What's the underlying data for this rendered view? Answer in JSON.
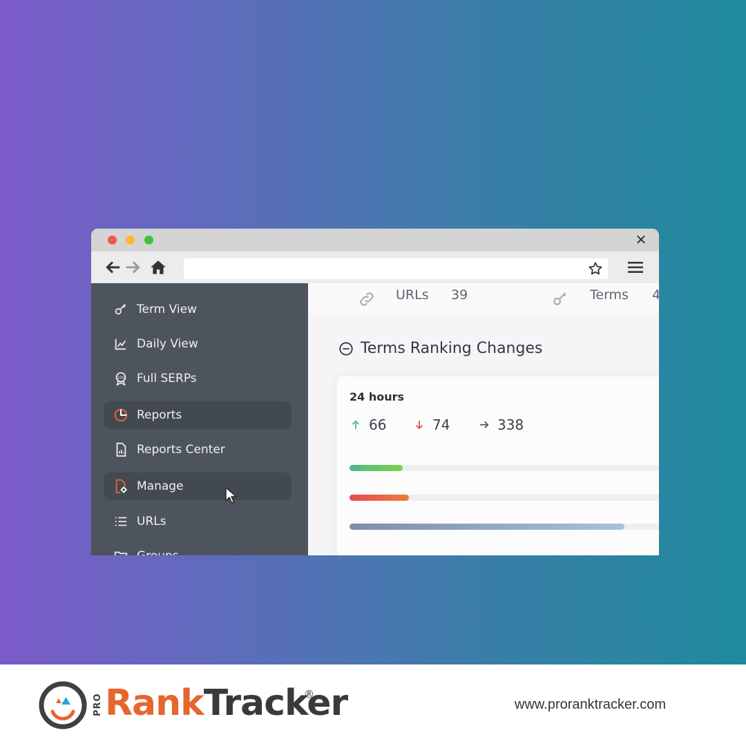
{
  "browser": {
    "url": ""
  },
  "stats": {
    "urls_label": "URLs",
    "urls_value": "39",
    "terms_label": "Terms",
    "terms_value": "4"
  },
  "sidebar": {
    "items": [
      {
        "label": "Term View",
        "icon": "key-icon",
        "active": false
      },
      {
        "label": "Daily View",
        "icon": "line-chart-icon",
        "active": false
      },
      {
        "label": "Full SERPs",
        "icon": "serp-100-badge-icon",
        "active": false
      },
      {
        "label": "Reports",
        "icon": "pie-chart-icon",
        "active": true
      },
      {
        "label": "Reports Center",
        "icon": "report-document-icon",
        "active": false
      },
      {
        "label": "Manage",
        "icon": "manage-document-gear-icon",
        "active": true
      },
      {
        "label": "URLs",
        "icon": "list-icon",
        "active": false
      },
      {
        "label": "Groups",
        "icon": "folder-icon",
        "active": false
      }
    ]
  },
  "main": {
    "section_title": "Terms Ranking Changes",
    "period": "24 hours",
    "up_count": "66",
    "down_count": "74",
    "same_count": "338",
    "bars": {
      "up_fraction": 0.16,
      "down_fraction": 0.18,
      "same_fraction": 0.83
    }
  },
  "colors": {
    "accent_orange": "#e6662e",
    "up_green": "#4cb88a",
    "down_red": "#e84a55",
    "sidebar_bg": "#4d545e"
  },
  "footer": {
    "brand_prefix": "PRO",
    "brand_rank": "Rank",
    "brand_tracker": "Tracker",
    "registered": "®",
    "website": "www.proranktracker.com"
  }
}
